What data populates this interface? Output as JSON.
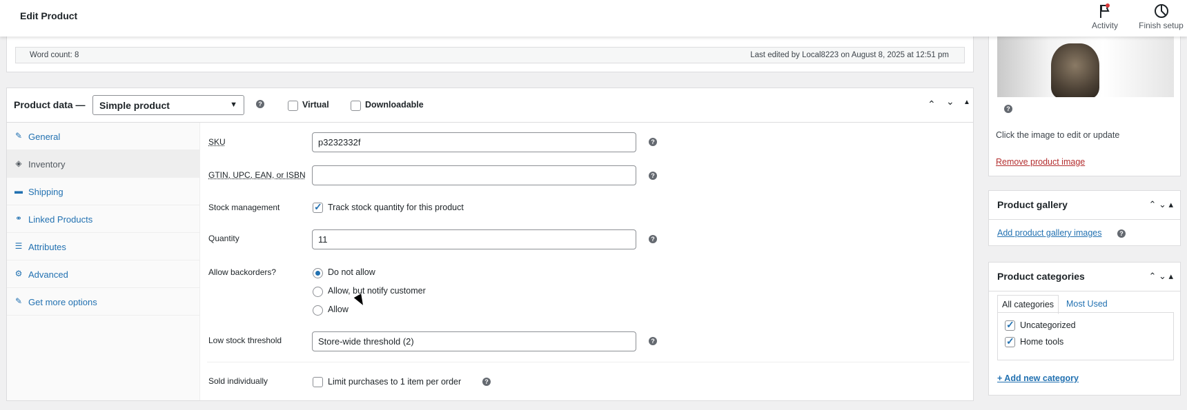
{
  "topbar": {
    "title": "Edit Product",
    "activity_label": "Activity",
    "finish_setup_label": "Finish setup"
  },
  "editor": {
    "word_count": "Word count: 8",
    "last_edited": "Last edited by Local8223 on August 8, 2025 at 12:51 pm"
  },
  "product_data": {
    "label": "Product data —",
    "type_selected": "Simple product",
    "virtual_label": "Virtual",
    "downloadable_label": "Downloadable",
    "tabs": [
      {
        "label": "General",
        "icon": "wrench-icon",
        "glyph": "✎"
      },
      {
        "label": "Inventory",
        "icon": "tag-icon",
        "glyph": "◈"
      },
      {
        "label": "Shipping",
        "icon": "truck-icon",
        "glyph": "▬"
      },
      {
        "label": "Linked Products",
        "icon": "link-icon",
        "glyph": "⚭"
      },
      {
        "label": "Attributes",
        "icon": "list-icon",
        "glyph": "☰"
      },
      {
        "label": "Advanced",
        "icon": "gear-icon",
        "glyph": "⚙"
      },
      {
        "label": "Get more options",
        "icon": "plugin-icon",
        "glyph": "✎"
      }
    ],
    "fields": {
      "sku_label": "SKU",
      "sku_value": "p3232332f",
      "gtin_label": "GTIN, UPC, EAN, or ISBN",
      "gtin_value": "",
      "stock_mgmt_label": "Stock management",
      "stock_mgmt_text": "Track stock quantity for this product",
      "quantity_label": "Quantity",
      "quantity_value": "11",
      "backorders_label": "Allow backorders?",
      "backorder_options": [
        "Do not allow",
        "Allow, but notify customer",
        "Allow"
      ],
      "backorder_selected": "Do not allow",
      "low_stock_label": "Low stock threshold",
      "low_stock_value": "Store-wide threshold (2)",
      "sold_individually_label": "Sold individually",
      "sold_individually_text": "Limit purchases to 1 item per order"
    }
  },
  "product_image": {
    "caption": "Click the image to edit or update",
    "remove_link": "Remove product image"
  },
  "gallery": {
    "title": "Product gallery",
    "add_link": "Add product gallery images"
  },
  "categories": {
    "title": "Product categories",
    "tab_all": "All categories",
    "tab_most_used": "Most Used",
    "items": [
      {
        "label": "Uncategorized",
        "checked": true
      },
      {
        "label": "Home tools",
        "checked": true
      }
    ],
    "add_link": "+ Add new category"
  },
  "colors": {
    "accent": "#2271b1",
    "danger": "#b32d2e"
  }
}
